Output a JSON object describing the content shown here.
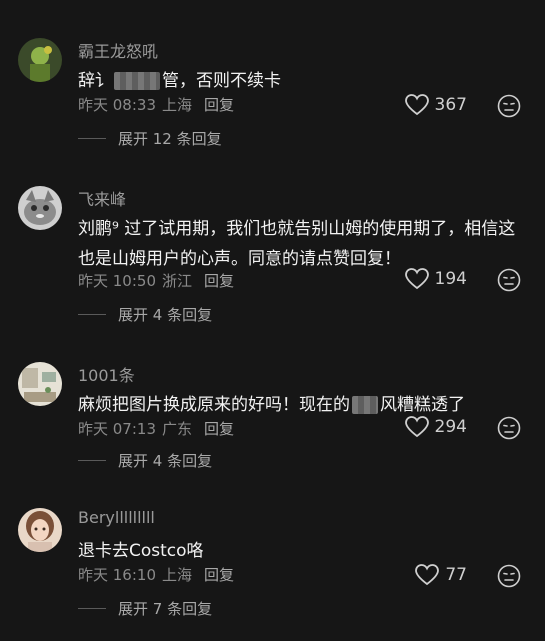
{
  "comments": [
    {
      "username": "霸王龙怒吼",
      "text_a": "辞讠",
      "text_b": "管，否则不续卡",
      "date": "昨天 08:33",
      "location": "上海",
      "reply": "回复",
      "likes": "367",
      "expand": "展开 12 条回复",
      "avatar_icon": "avatar-green-figure"
    },
    {
      "username": "飞来峰",
      "text_a": "刘鹏⁹ 过了试用期，我们也就告别山姆的使用期了，相信这也是山姆用户的心声。同意的请点赞回复！",
      "date": "昨天 10:50",
      "location": "浙江",
      "reply": "回复",
      "likes": "194",
      "expand": "展开 4 条回复",
      "avatar_icon": "avatar-cat"
    },
    {
      "username": "1001条",
      "text_a": "麻烦把图片换成原来的好吗！现在的",
      "text_b": "风糟糕透了",
      "date": "昨天 07:13",
      "location": "广东",
      "reply": "回复",
      "likes": "294",
      "expand": "展开 4 条回复",
      "avatar_icon": "avatar-room"
    },
    {
      "username": "Berylllllllll",
      "text_a": "退卡去Costco咯",
      "date": "昨天 16:10",
      "location": "上海",
      "reply": "回复",
      "likes": "77",
      "expand": "展开 7 条回复",
      "avatar_icon": "avatar-girl"
    }
  ]
}
